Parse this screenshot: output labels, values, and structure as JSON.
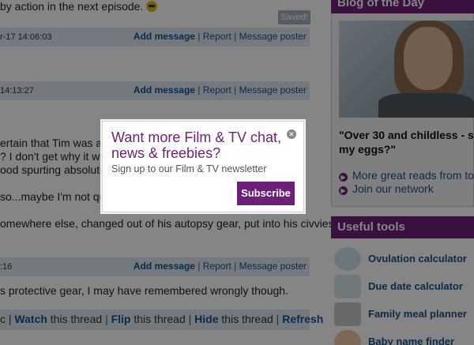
{
  "forum": {
    "line1": "by action in the next episode.",
    "saved_badge": "Saved!",
    "posts": [
      {
        "date": "r-17 14:06:03"
      },
      {
        "date": "14:13:27"
      },
      {
        "date": ":16"
      }
    ],
    "actions": {
      "add_message": "Add message",
      "separator": "|",
      "report": "Report",
      "message_poster": "Message poster"
    },
    "body_lines": [
      "ertain that Tim was act",
      "? I don't get why it was",
      "ood spurting absolutely",
      " so...maybe I'm not qui",
      "omewhere else, changed out of his autopsy gear, put into his civvies",
      "s protective gear, I may have remembered wrongly though."
    ],
    "thread_tools": {
      "prefix": "c |",
      "watch": "Watch",
      "flip": "Flip",
      "hide": "Hide",
      "refresh": "Refresh",
      "this_thread": "this thread"
    }
  },
  "sidebar": {
    "blog_heading": "Blog of the Day",
    "blog_title_line1": "\"Over 30 and childless - shoul",
    "blog_title_line2": "my eggs?\"",
    "links": [
      {
        "label": "More great reads from toda"
      },
      {
        "label": "Join our network"
      }
    ],
    "tools_heading": "Useful tools",
    "tools": [
      {
        "label": "Ovulation calculator",
        "icon": "ovulation-icon"
      },
      {
        "label": "Due date calculator",
        "icon": "due-date-icon"
      },
      {
        "label": "Family meal planner",
        "icon": "meal-planner-icon"
      },
      {
        "label": "Baby name finder",
        "icon": "baby-name-icon"
      }
    ]
  },
  "modal": {
    "title": "Want more Film & TV chat, news & freebies?",
    "subtitle": "Sign up to our Film & TV newsletter",
    "subscribe_label": "Subscribe",
    "close_glyph": "✕"
  },
  "colors": {
    "brand_purple": "#6e1f77",
    "link_blue": "#1a4f8a",
    "meta_bar": "#dce8f3"
  }
}
